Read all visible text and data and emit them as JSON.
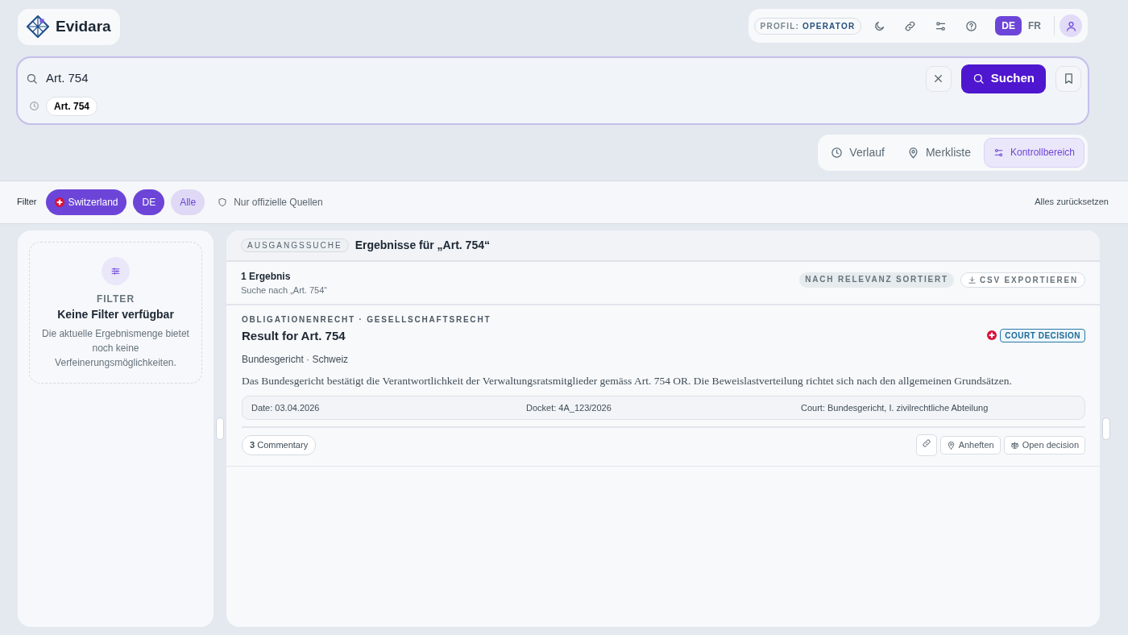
{
  "brand": {
    "name": "Evidara"
  },
  "profile": {
    "label": "PROFIL:",
    "value": "OPERATOR"
  },
  "toolbar": [
    {
      "kind": "moon"
    },
    {
      "kind": "link"
    },
    {
      "kind": "sliders"
    },
    {
      "kind": "help"
    }
  ],
  "languages": [
    {
      "label": "DE",
      "selected": true
    },
    {
      "label": "FR",
      "selected": false
    }
  ],
  "search": {
    "value": "Art. 754",
    "button": "Suchen",
    "recent": [
      "Art. 754"
    ]
  },
  "views": [
    {
      "label": "Verlauf",
      "kind": "clock",
      "selected": false
    },
    {
      "label": "Merkliste",
      "kind": "pin",
      "selected": false
    },
    {
      "label": "Kontrollbereich",
      "kind": "sliders",
      "selected": true
    }
  ],
  "filter_bar": {
    "label": "Filter",
    "chips": [
      {
        "label": "Switzerland",
        "kind": "country",
        "selected": true
      },
      {
        "label": "DE",
        "kind": "language",
        "selected": true
      },
      {
        "label": "Alle",
        "kind": "scope",
        "selected": false
      }
    ],
    "official": "Nur offizielle Quellen",
    "reset": "Alles zurücksetzen"
  },
  "sidebar": {
    "heading": "FILTER",
    "title": "Keine Filter verfügbar",
    "text": "Die aktuelle Ergebnismenge bietet noch keine Verfeinerungsmöglichkeiten."
  },
  "results": {
    "tag": "AUSGANGSSUCHE",
    "title": "Ergebnisse für „Art. 754“",
    "count": "1 Ergebnis",
    "subtitle": "Suche nach „Art. 754“",
    "sort": "NACH RELEVANZ SORTIERT",
    "export": "CSV EXPORTIEREN",
    "items": [
      {
        "categories": "OBLIGATIONENRECHT · GESELLSCHAFTSRECHT",
        "title": "Result for Art. 754",
        "type": "COURT DECISION",
        "source": "Bundesgericht · Schweiz",
        "summary": "Das Bundesgericht bestätigt die Verantwortlichkeit der Verwaltungsratsmitglieder gemäss Art. 754 OR. Die Beweislastverteilung richtet sich nach den allgemeinen Grundsätzen.",
        "meta": [
          {
            "label": "Date:",
            "value": "03.04.2026"
          },
          {
            "label": "Docket:",
            "value": "4A_123/2026"
          },
          {
            "label": "Court:",
            "value": "Bundesgericht, I. zivilrechtliche Abteilung"
          }
        ],
        "commentary_count": "3",
        "commentary_label": "Commentary",
        "actions": [
          {
            "label": "Anheften",
            "kind": "pin"
          },
          {
            "label": "Open decision",
            "kind": "scale"
          }
        ]
      }
    ]
  }
}
